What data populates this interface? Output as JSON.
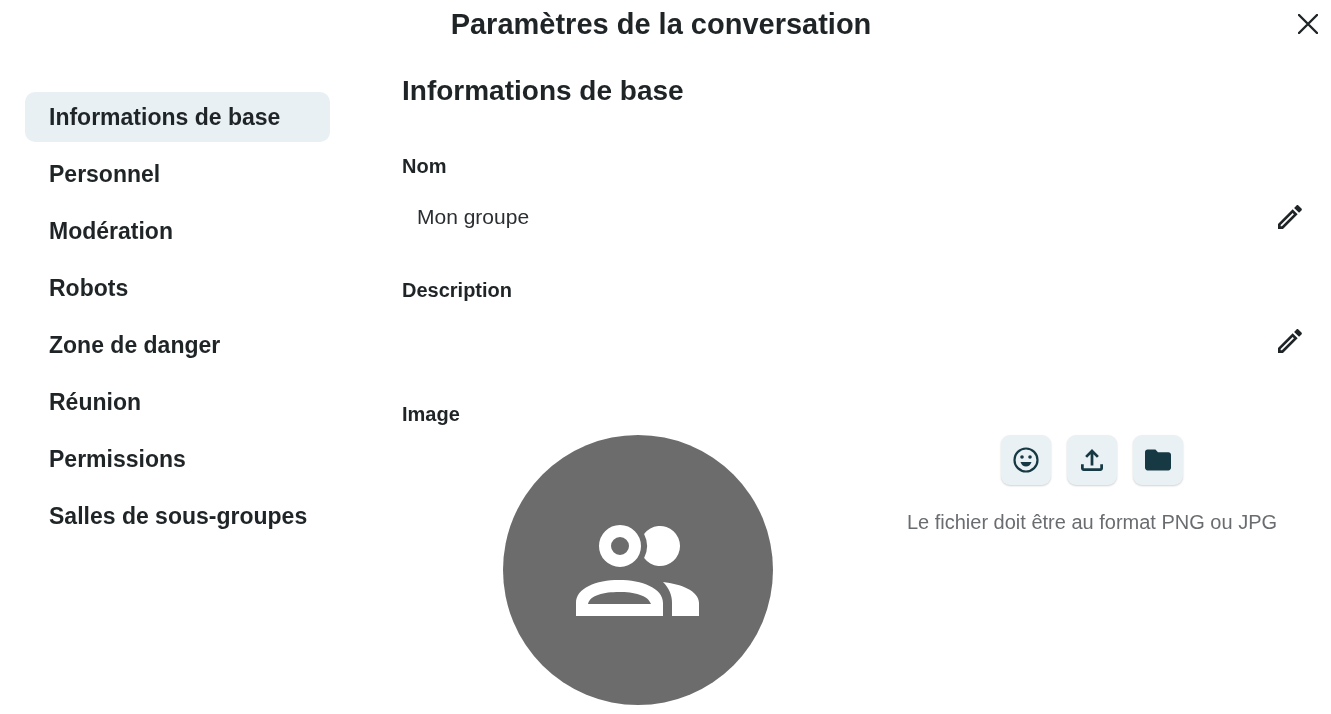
{
  "dialog": {
    "title": "Paramètres de la conversation"
  },
  "sidebar": {
    "items": [
      {
        "label": "Informations de base",
        "selected": true
      },
      {
        "label": "Personnel",
        "selected": false
      },
      {
        "label": "Modération",
        "selected": false
      },
      {
        "label": "Robots",
        "selected": false
      },
      {
        "label": "Zone de danger",
        "selected": false
      },
      {
        "label": "Réunion",
        "selected": false
      },
      {
        "label": "Permissions",
        "selected": false
      },
      {
        "label": "Salles de sous-groupes",
        "selected": false
      }
    ]
  },
  "section": {
    "heading": "Informations de base",
    "fields": [
      {
        "label": "Nom",
        "value": "Mon groupe"
      },
      {
        "label": "Description"
      }
    ],
    "image": {
      "label": "Image",
      "hint": "Le fichier doit être au format PNG ou JPG"
    }
  }
}
